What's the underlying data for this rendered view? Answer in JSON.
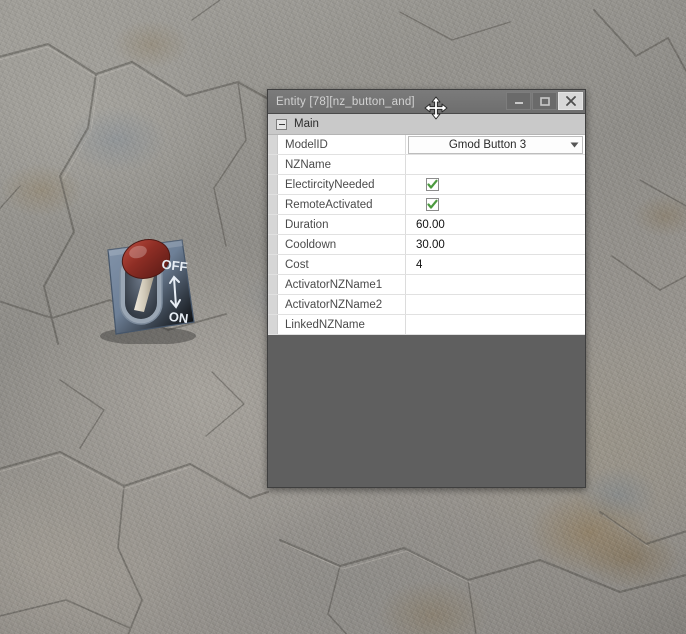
{
  "window": {
    "title": "Entity [78][nz_button_and]",
    "controls": [
      {
        "name": "minimize-button",
        "icon": "minimize-icon",
        "label": "Minimize"
      },
      {
        "name": "maximize-button",
        "icon": "maximize-icon",
        "label": "Maximize"
      },
      {
        "name": "close-button",
        "icon": "close-icon",
        "label": "Close"
      }
    ]
  },
  "grid": {
    "group": {
      "label": "Main",
      "expanded": true,
      "expander_icon": "minus-box-icon"
    },
    "rows": [
      {
        "name": "ModelID",
        "value": "Gmod Button 3",
        "editor": "combo",
        "checked": false
      },
      {
        "name": "NZName",
        "value": "",
        "editor": "text",
        "checked": false
      },
      {
        "name": "ElectircityNeeded",
        "value": "",
        "editor": "checkbox",
        "checked": true
      },
      {
        "name": "RemoteActivated",
        "value": "",
        "editor": "checkbox",
        "checked": true
      },
      {
        "name": "Duration",
        "value": "60.00",
        "editor": "text",
        "checked": false
      },
      {
        "name": "Cooldown",
        "value": "30.00",
        "editor": "text",
        "checked": false
      },
      {
        "name": "Cost",
        "value": "4",
        "editor": "text",
        "checked": false
      },
      {
        "name": "ActivatorNZName1",
        "value": "",
        "editor": "text",
        "checked": false
      },
      {
        "name": "ActivatorNZName2",
        "value": "",
        "editor": "text",
        "checked": false
      },
      {
        "name": "LinkedNZName",
        "value": "",
        "editor": "text",
        "checked": false
      }
    ]
  },
  "scene": {
    "background": "stone-ground-texture",
    "prop": {
      "name": "lever-switch-prop",
      "label_top": "OFF",
      "label_bottom": "ON",
      "knob_color": "#8f2d25",
      "plate_color": "#6d7f95"
    }
  },
  "cursor": {
    "icon": "move-cursor-icon"
  },
  "colors": {
    "window_body": "#5f5f5f",
    "title_bar": "#6e6e6e",
    "title_text": "#d2d2d2",
    "group_header": "#c9c9c9",
    "grid_background": "#ffffff",
    "row_border": "#e1e1e1",
    "label_text": "#4a4a4a",
    "value_text": "#111111",
    "check_green": "#4c9a3f"
  }
}
